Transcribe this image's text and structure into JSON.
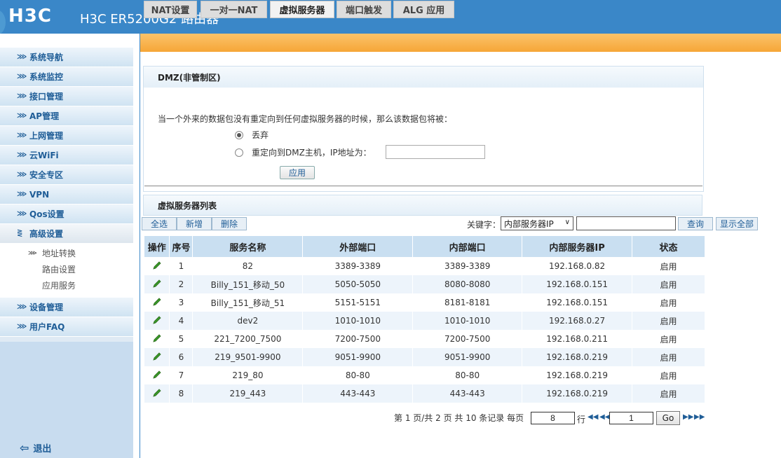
{
  "header": {
    "logo": "H3C",
    "title": "H3C ER5200G2 路由器"
  },
  "sidebar": {
    "items": [
      {
        "label": "系统导航"
      },
      {
        "label": "系统监控"
      },
      {
        "label": "接口管理"
      },
      {
        "label": "AP管理"
      },
      {
        "label": "上网管理"
      },
      {
        "label": "云WiFi"
      },
      {
        "label": "安全专区"
      },
      {
        "label": "VPN"
      },
      {
        "label": "Qos设置"
      },
      {
        "label": "高级设置"
      }
    ],
    "subitems": [
      {
        "label": "地址转换"
      },
      {
        "label": "路由设置"
      },
      {
        "label": "应用服务"
      }
    ],
    "items2": [
      {
        "label": "设备管理"
      },
      {
        "label": "用户FAQ"
      }
    ],
    "logout": "退出"
  },
  "tabs": [
    {
      "label": "NAT设置"
    },
    {
      "label": "一对一NAT"
    },
    {
      "label": "虚拟服务器"
    },
    {
      "label": "端口触发"
    },
    {
      "label": "ALG 应用"
    }
  ],
  "dmz": {
    "title": "DMZ(非管制区)",
    "description": "当一个外来的数据包没有重定向到任何虚拟服务器的时候，那么该数据包将被：",
    "option_drop": "丢弃",
    "option_redirect": "重定向到DMZ主机，IP地址为：",
    "ip_value": "",
    "apply": "应用"
  },
  "list": {
    "title": "虚拟服务器列表",
    "select_all": "全选",
    "add": "新增",
    "delete": "删除",
    "keyword_label": "关键字：",
    "keyword_select": "内部服务器IP",
    "keyword_value": "",
    "search": "查询",
    "show_all": "显示全部"
  },
  "table": {
    "headers": [
      "操作",
      "序号",
      "服务名称",
      "外部端口",
      "内部端口",
      "内部服务器IP",
      "状态"
    ],
    "rows": [
      [
        "1",
        "82",
        "3389-3389",
        "3389-3389",
        "192.168.0.82",
        "启用"
      ],
      [
        "2",
        "Billy_151_移动_50",
        "5050-5050",
        "8080-8080",
        "192.168.0.151",
        "启用"
      ],
      [
        "3",
        "Billy_151_移动_51",
        "5151-5151",
        "8181-8181",
        "192.168.0.151",
        "启用"
      ],
      [
        "4",
        "dev2",
        "1010-1010",
        "1010-1010",
        "192.168.0.27",
        "启用"
      ],
      [
        "5",
        "221_7200_7500",
        "7200-7500",
        "7200-7500",
        "192.168.0.211",
        "启用"
      ],
      [
        "6",
        "219_9501-9900",
        "9051-9900",
        "9051-9900",
        "192.168.0.219",
        "启用"
      ],
      [
        "7",
        "219_80",
        "80-80",
        "80-80",
        "192.168.0.219",
        "启用"
      ],
      [
        "8",
        "219_443",
        "443-443",
        "443-443",
        "192.168.0.219",
        "启用"
      ]
    ]
  },
  "pager": {
    "summary": "第 1 页/共 2 页 共 10 条记录 每页",
    "per_page": "8",
    "row_unit": "行",
    "page_value": "1",
    "go": "Go"
  },
  "colors": {
    "header_bg": "#3a87c8",
    "tab_bar": "#f6a637",
    "table_head": "#c9dff1",
    "pencil": "#3a9a2a"
  }
}
